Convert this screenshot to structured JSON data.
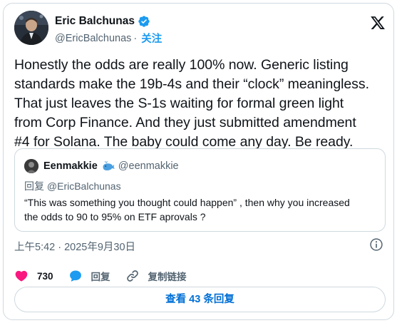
{
  "author": {
    "name": "Eric Balchunas",
    "handle": "@EricBalchunas",
    "separator": "·",
    "follow_label": "关注",
    "verified_icon": "verified-badge-icon"
  },
  "platform_icon": "x-logo-icon",
  "tweet": {
    "lines": [
      "Honestly the odds are really 100% now. Generic listing",
      "standards make the 19b-4s and their “clock” meaningless.",
      "That just leaves the S-1s waiting for formal green light",
      "from Corp Finance. And they just submitted amendment",
      "#4 for Solana. The baby could come any day. Be ready."
    ]
  },
  "quote": {
    "name": "Eenmakkie",
    "emoji_icon": "whale-icon",
    "handle": "@eenmakkie",
    "reply_prefix": "回复",
    "reply_handle": "@EricBalchunas",
    "lines": [
      "“This was something you thought could happen” , then why you increased",
      "the odds to 90 to 95% on ETF aprovals ?"
    ]
  },
  "meta": {
    "timestamp": "上午5:42 · 2025年9月30日",
    "info_icon": "info-icon"
  },
  "actions": {
    "like_count": "730",
    "reply_label": "回复",
    "copy_link_label": "复制链接"
  },
  "read_replies_label": "查看 43 条回复",
  "colors": {
    "accent": "#1d9bf0",
    "like": "#f91880",
    "link_button": "#006fd6",
    "muted": "#536471"
  }
}
